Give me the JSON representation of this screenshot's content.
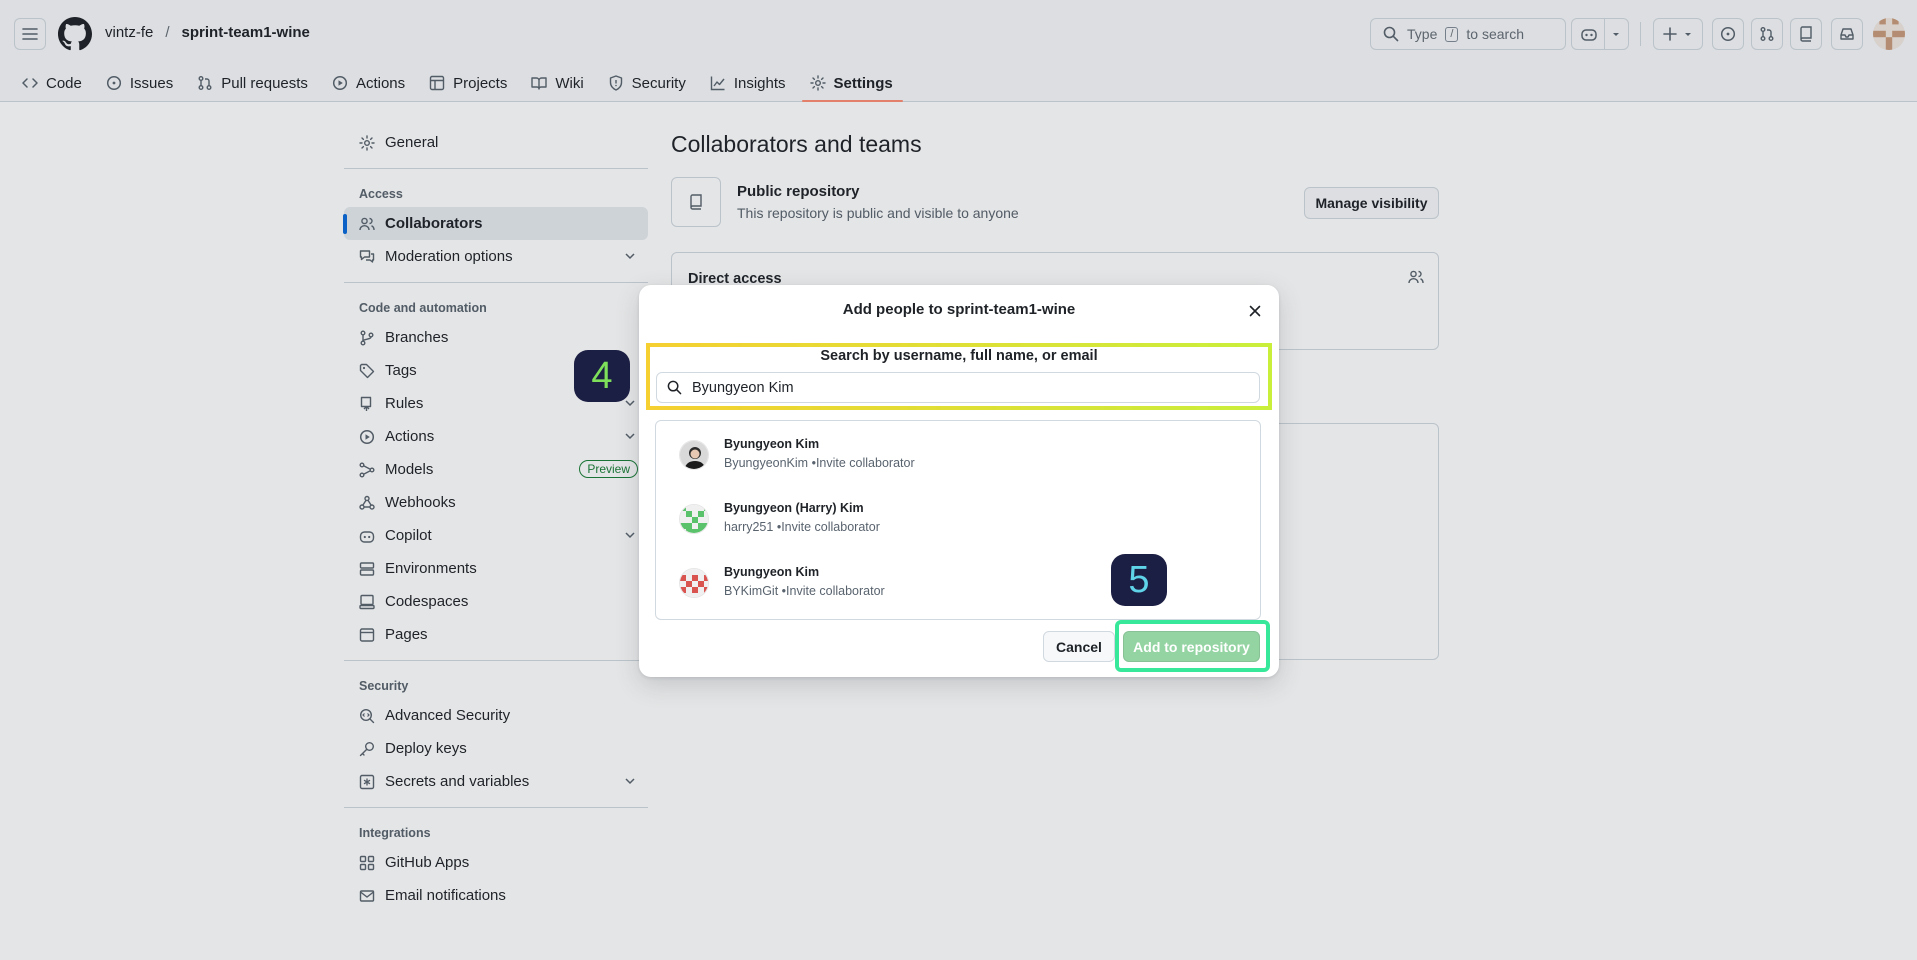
{
  "header": {
    "owner": "vintz-fe",
    "separator": "/",
    "repo": "sprint-team1-wine",
    "search_prefix": "Type",
    "search_key": "/",
    "search_suffix": "to search"
  },
  "tabs": [
    {
      "label": "Code",
      "icon": "code-icon"
    },
    {
      "label": "Issues",
      "icon": "issue-icon"
    },
    {
      "label": "Pull requests",
      "icon": "pull-request-icon"
    },
    {
      "label": "Actions",
      "icon": "play-icon"
    },
    {
      "label": "Projects",
      "icon": "table-icon"
    },
    {
      "label": "Wiki",
      "icon": "book-icon"
    },
    {
      "label": "Security",
      "icon": "shield-icon"
    },
    {
      "label": "Insights",
      "icon": "graph-icon"
    },
    {
      "label": "Settings",
      "icon": "gear-icon",
      "selected": true
    }
  ],
  "sidebar": {
    "general": "General",
    "access_heading": "Access",
    "collaborators": "Collaborators",
    "moderation": "Moderation options",
    "code_heading": "Code and automation",
    "branches": "Branches",
    "tags": "Tags",
    "rules": "Rules",
    "actions": "Actions",
    "models": "Models",
    "models_badge": "Preview",
    "webhooks": "Webhooks",
    "copilot": "Copilot",
    "environments": "Environments",
    "codespaces": "Codespaces",
    "pages": "Pages",
    "security_heading": "Security",
    "advanced_security": "Advanced Security",
    "deploy_keys": "Deploy keys",
    "secrets": "Secrets and variables",
    "integrations_heading": "Integrations",
    "github_apps": "GitHub Apps",
    "email_notifications": "Email notifications"
  },
  "main": {
    "title": "Collaborators and teams",
    "public_title": "Public repository",
    "public_desc": "This repository is public and visible to anyone",
    "manage_visibility": "Manage visibility",
    "direct_access": "Direct access"
  },
  "dialog": {
    "title": "Add people to sprint-team1-wine",
    "search_label": "Search by username, full name, or email",
    "search_value": "Byungyeon Kim",
    "results": [
      {
        "name": "Byungyeon Kim",
        "login": "ByungyeonKim",
        "action": "•Invite collaborator"
      },
      {
        "name": "Byungyeon (Harry) Kim",
        "login": "harry251",
        "action": "•Invite collaborator"
      },
      {
        "name": "Byungyeon Kim",
        "login": "BYKimGit",
        "action": "•Invite collaborator"
      }
    ],
    "cancel": "Cancel",
    "add": "Add to repository"
  },
  "steps": {
    "four": "4",
    "five": "5"
  },
  "colors": {
    "accent_blue": "#0969da",
    "selected_tab_underline": "#fd8c73",
    "add_button_disabled": "#94d3a2",
    "highlight_yellow": "#e8df38",
    "highlight_green": "#38e89a",
    "step_badge_bg": "#1c1f44",
    "step4_text": "#7ee05a",
    "step5_text": "#5fd3e8"
  }
}
